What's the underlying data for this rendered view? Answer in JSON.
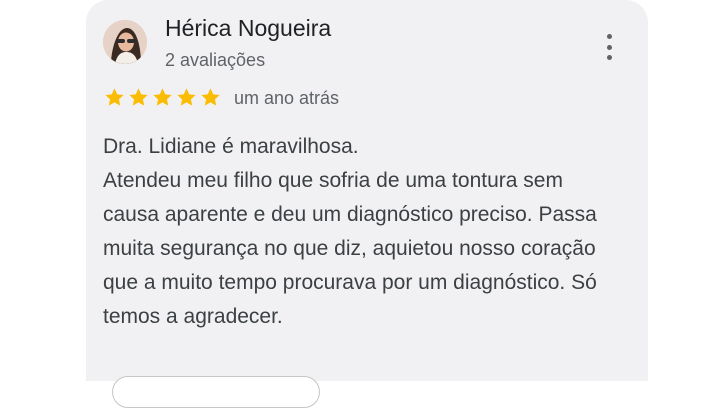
{
  "review": {
    "reviewer_name": "Hérica Nogueira",
    "review_count": "2 avaliações",
    "rating": 5,
    "max_rating": 5,
    "time_ago": "um ano atrás",
    "text_lines": [
      "Dra. Lidiane é maravilhosa.",
      "Atendeu meu filho que sofria de uma tontura sem causa aparente e deu um diagnóstico preciso. Passa muita segurança no que diz, aquietou nosso coração que a muito tempo procurava por um diagnóstico. Só temos a agradecer."
    ]
  },
  "icons": {
    "more": "more-vert-icon",
    "star": "star-icon"
  },
  "colors": {
    "card_background": "#f1f1f3",
    "star": "#fbbc04",
    "name_text": "#202124",
    "secondary_text": "#5f6368",
    "body_text": "#3c4043"
  }
}
